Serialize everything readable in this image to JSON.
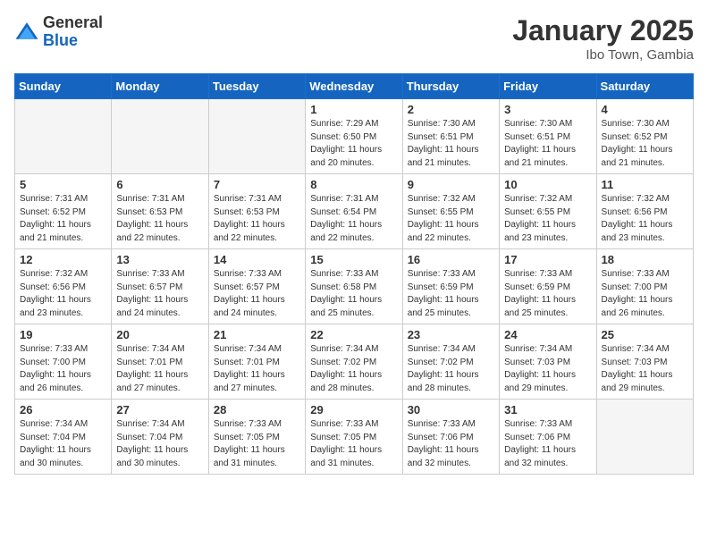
{
  "logo": {
    "general": "General",
    "blue": "Blue"
  },
  "header": {
    "month": "January 2025",
    "location": "Ibo Town, Gambia"
  },
  "weekdays": [
    "Sunday",
    "Monday",
    "Tuesday",
    "Wednesday",
    "Thursday",
    "Friday",
    "Saturday"
  ],
  "weeks": [
    [
      {
        "day": "",
        "info": ""
      },
      {
        "day": "",
        "info": ""
      },
      {
        "day": "",
        "info": ""
      },
      {
        "day": "1",
        "info": "Sunrise: 7:29 AM\nSunset: 6:50 PM\nDaylight: 11 hours\nand 20 minutes."
      },
      {
        "day": "2",
        "info": "Sunrise: 7:30 AM\nSunset: 6:51 PM\nDaylight: 11 hours\nand 21 minutes."
      },
      {
        "day": "3",
        "info": "Sunrise: 7:30 AM\nSunset: 6:51 PM\nDaylight: 11 hours\nand 21 minutes."
      },
      {
        "day": "4",
        "info": "Sunrise: 7:30 AM\nSunset: 6:52 PM\nDaylight: 11 hours\nand 21 minutes."
      }
    ],
    [
      {
        "day": "5",
        "info": "Sunrise: 7:31 AM\nSunset: 6:52 PM\nDaylight: 11 hours\nand 21 minutes."
      },
      {
        "day": "6",
        "info": "Sunrise: 7:31 AM\nSunset: 6:53 PM\nDaylight: 11 hours\nand 22 minutes."
      },
      {
        "day": "7",
        "info": "Sunrise: 7:31 AM\nSunset: 6:53 PM\nDaylight: 11 hours\nand 22 minutes."
      },
      {
        "day": "8",
        "info": "Sunrise: 7:31 AM\nSunset: 6:54 PM\nDaylight: 11 hours\nand 22 minutes."
      },
      {
        "day": "9",
        "info": "Sunrise: 7:32 AM\nSunset: 6:55 PM\nDaylight: 11 hours\nand 22 minutes."
      },
      {
        "day": "10",
        "info": "Sunrise: 7:32 AM\nSunset: 6:55 PM\nDaylight: 11 hours\nand 23 minutes."
      },
      {
        "day": "11",
        "info": "Sunrise: 7:32 AM\nSunset: 6:56 PM\nDaylight: 11 hours\nand 23 minutes."
      }
    ],
    [
      {
        "day": "12",
        "info": "Sunrise: 7:32 AM\nSunset: 6:56 PM\nDaylight: 11 hours\nand 23 minutes."
      },
      {
        "day": "13",
        "info": "Sunrise: 7:33 AM\nSunset: 6:57 PM\nDaylight: 11 hours\nand 24 minutes."
      },
      {
        "day": "14",
        "info": "Sunrise: 7:33 AM\nSunset: 6:57 PM\nDaylight: 11 hours\nand 24 minutes."
      },
      {
        "day": "15",
        "info": "Sunrise: 7:33 AM\nSunset: 6:58 PM\nDaylight: 11 hours\nand 25 minutes."
      },
      {
        "day": "16",
        "info": "Sunrise: 7:33 AM\nSunset: 6:59 PM\nDaylight: 11 hours\nand 25 minutes."
      },
      {
        "day": "17",
        "info": "Sunrise: 7:33 AM\nSunset: 6:59 PM\nDaylight: 11 hours\nand 25 minutes."
      },
      {
        "day": "18",
        "info": "Sunrise: 7:33 AM\nSunset: 7:00 PM\nDaylight: 11 hours\nand 26 minutes."
      }
    ],
    [
      {
        "day": "19",
        "info": "Sunrise: 7:33 AM\nSunset: 7:00 PM\nDaylight: 11 hours\nand 26 minutes."
      },
      {
        "day": "20",
        "info": "Sunrise: 7:34 AM\nSunset: 7:01 PM\nDaylight: 11 hours\nand 27 minutes."
      },
      {
        "day": "21",
        "info": "Sunrise: 7:34 AM\nSunset: 7:01 PM\nDaylight: 11 hours\nand 27 minutes."
      },
      {
        "day": "22",
        "info": "Sunrise: 7:34 AM\nSunset: 7:02 PM\nDaylight: 11 hours\nand 28 minutes."
      },
      {
        "day": "23",
        "info": "Sunrise: 7:34 AM\nSunset: 7:02 PM\nDaylight: 11 hours\nand 28 minutes."
      },
      {
        "day": "24",
        "info": "Sunrise: 7:34 AM\nSunset: 7:03 PM\nDaylight: 11 hours\nand 29 minutes."
      },
      {
        "day": "25",
        "info": "Sunrise: 7:34 AM\nSunset: 7:03 PM\nDaylight: 11 hours\nand 29 minutes."
      }
    ],
    [
      {
        "day": "26",
        "info": "Sunrise: 7:34 AM\nSunset: 7:04 PM\nDaylight: 11 hours\nand 30 minutes."
      },
      {
        "day": "27",
        "info": "Sunrise: 7:34 AM\nSunset: 7:04 PM\nDaylight: 11 hours\nand 30 minutes."
      },
      {
        "day": "28",
        "info": "Sunrise: 7:33 AM\nSunset: 7:05 PM\nDaylight: 11 hours\nand 31 minutes."
      },
      {
        "day": "29",
        "info": "Sunrise: 7:33 AM\nSunset: 7:05 PM\nDaylight: 11 hours\nand 31 minutes."
      },
      {
        "day": "30",
        "info": "Sunrise: 7:33 AM\nSunset: 7:06 PM\nDaylight: 11 hours\nand 32 minutes."
      },
      {
        "day": "31",
        "info": "Sunrise: 7:33 AM\nSunset: 7:06 PM\nDaylight: 11 hours\nand 32 minutes."
      },
      {
        "day": "",
        "info": ""
      }
    ]
  ]
}
